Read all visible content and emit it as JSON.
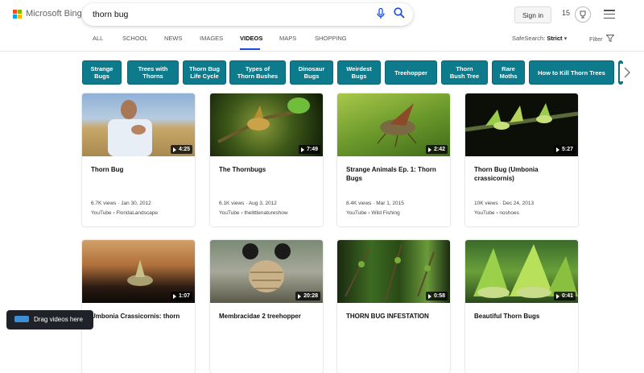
{
  "brand": {
    "name": "Microsoft Bing",
    "colors": [
      "#f25022",
      "#7fba00",
      "#00a4ef",
      "#ffb900"
    ]
  },
  "search": {
    "query": "thorn bug",
    "mic_icon": "microphone-icon",
    "search_icon": "search-icon"
  },
  "header": {
    "sign_in": "Sign in",
    "rewards_count": "15",
    "rewards_icon": "trophy-icon",
    "menu_icon": "hamburger-icon"
  },
  "nav": {
    "tabs": [
      "ALL",
      "SCHOOL",
      "NEWS",
      "IMAGES",
      "VIDEOS",
      "MAPS",
      "SHOPPING"
    ],
    "active": "VIDEOS",
    "safesearch_label": "SafeSearch:",
    "safesearch_value": "Strict",
    "filter_label": "Filter"
  },
  "chips": [
    {
      "line1": "Strange",
      "line2": "Bugs"
    },
    {
      "line1": "Trees with",
      "line2": "Thorns"
    },
    {
      "line1": "Thorn Bug",
      "line2": "Life Cycle"
    },
    {
      "line1": "Types of",
      "line2": "Thorn Bushes"
    },
    {
      "line1": "Dinosaur",
      "line2": "Bugs"
    },
    {
      "line1": "Weirdest",
      "line2": "Bugs"
    },
    {
      "line1": "Treehopper",
      "line2": ""
    },
    {
      "line1": "Thorn",
      "line2": "Bush Tree"
    },
    {
      "line1": "Rare",
      "line2": "Moths"
    },
    {
      "line1": "How to Kill Thorn Trees",
      "line2": ""
    }
  ],
  "videos": [
    {
      "title": "Thorn Bug",
      "duration": "4:25",
      "meta": "6.7K views · Jan 30, 2012",
      "source": "YouTube › FloridaLandscape"
    },
    {
      "title": "The Thornbugs",
      "duration": "7:49",
      "meta": "6.1K views · Aug 3, 2012",
      "source": "YouTube › thelittlenatureshow"
    },
    {
      "title": "Strange Animals Ep. 1: Thorn Bugs",
      "duration": "2:42",
      "meta": "8.4K views · Mar 1, 2015",
      "source": "YouTube › Wild Fishing"
    },
    {
      "title": "Thorn Bug (Umbonia crassicornis)",
      "duration": "5:27",
      "meta": "10K views · Dec 24, 2013",
      "source": "YouTube › noshoes"
    },
    {
      "title": "Umbonia Crassicornis: thorn",
      "duration": "1:07",
      "meta": "",
      "source": ""
    },
    {
      "title": "Membracidae 2 treehopper",
      "duration": "20:28",
      "meta": "",
      "source": ""
    },
    {
      "title": "THORN BUG INFESTATION",
      "duration": "0:58",
      "meta": "",
      "source": ""
    },
    {
      "title": "Beautiful Thorn Bugs",
      "duration": "0:41",
      "meta": "",
      "source": ""
    }
  ],
  "toast": {
    "text": "Drag videos here"
  }
}
